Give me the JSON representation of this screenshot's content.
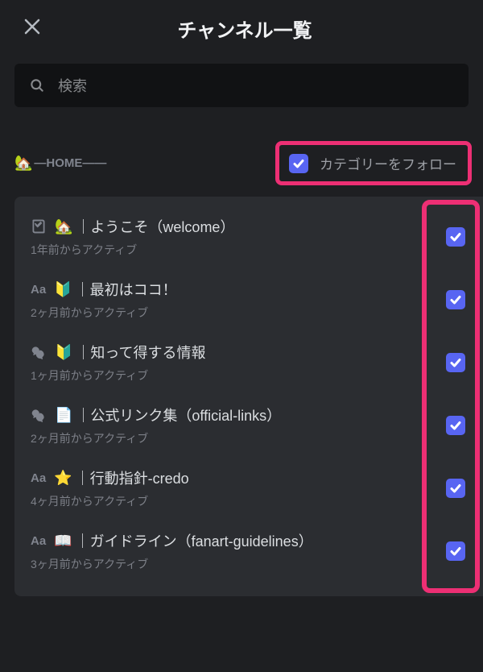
{
  "header": {
    "title": "チャンネル一覧"
  },
  "search": {
    "placeholder": "検索"
  },
  "category": {
    "icon": "🏡",
    "label": "—HOME——",
    "follow_label": "カテゴリーをフォロー"
  },
  "channels": [
    {
      "type": "rules",
      "emoji": "🏡",
      "name": "｜ようこそ（welcome）",
      "meta": "1年前からアクティブ"
    },
    {
      "type": "text",
      "emoji": "🔰",
      "name": "｜最初はココ！",
      "meta": "2ヶ月前からアクティブ"
    },
    {
      "type": "forum",
      "emoji": "🔰",
      "name": "｜知って得する情報",
      "meta": "1ヶ月前からアクティブ"
    },
    {
      "type": "forum",
      "emoji": "📄",
      "name": "｜公式リンク集（official-links）",
      "meta": "2ヶ月前からアクティブ"
    },
    {
      "type": "text",
      "emoji": "⭐",
      "name": "｜行動指針-credo",
      "meta": "4ヶ月前からアクティブ"
    },
    {
      "type": "text",
      "emoji": "📖",
      "name": "｜ガイドライン（fanart-guidelines）",
      "meta": "3ヶ月前からアクティブ"
    }
  ]
}
